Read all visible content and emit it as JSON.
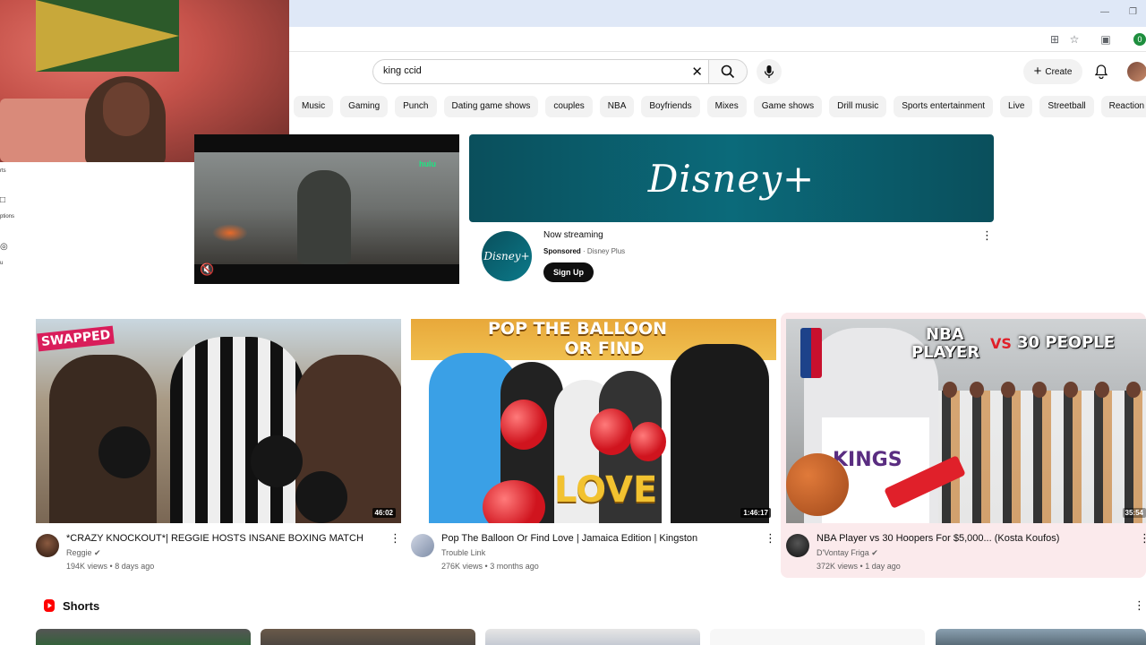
{
  "browser": {
    "profile_initial": "0",
    "icons": [
      "install-icon",
      "star-icon",
      "extensions-icon",
      "minimize-icon",
      "restore-icon"
    ]
  },
  "header": {
    "search_value": "king ccid",
    "create_label": "Create"
  },
  "chips": [
    "Music",
    "Gaming",
    "Punch",
    "Dating game shows",
    "couples",
    "NBA",
    "Boyfriends",
    "Mixes",
    "Game shows",
    "Drill music",
    "Sports entertainment",
    "Live",
    "Streetball",
    "Reaction vic"
  ],
  "ad": {
    "brand_logo_text": "Disney+",
    "video_badge": "hulu",
    "title": "Now streaming",
    "sponsored_label": "Sponsored",
    "advertiser": "Disney Plus",
    "cta_label": "Sign Up"
  },
  "videos": [
    {
      "title": "*CRAZY KNOCKOUT*| REGGIE HOSTS INSANE BOXING MATCH",
      "channel": "Reggie",
      "views": "194K views",
      "age": "8 days ago",
      "duration": "46:02",
      "thumb_text": "SWAPPED"
    },
    {
      "title": "Pop The Balloon Or Find Love | Jamaica Edition | Kingston",
      "channel": "Trouble Link",
      "views": "276K views",
      "age": "3 months ago",
      "duration": "1:46:17",
      "thumb_text_top": "POP THE BALLOON",
      "thumb_text_mid": "OR FIND",
      "thumb_text_love": "LOVE"
    },
    {
      "title": "NBA Player vs 30 Hoopers For $5,000... (Kosta Koufos)",
      "channel": "D'Vontay Friga",
      "views": "372K views",
      "age": "1 day ago",
      "duration": "35:54",
      "thumb_text_a": "NBA",
      "thumb_text_b": "PLAYER",
      "thumb_text_vs": "VS",
      "thumb_text_c": "30 PEOPLE",
      "thumb_jersey": "KINGS"
    }
  ],
  "shorts": {
    "label": "Shorts"
  },
  "sidebar_fragments": [
    "rts",
    "ptions",
    "u"
  ],
  "colors": {
    "accent_red": "#ff0000",
    "chip_bg": "#f2f2f2",
    "disney_teal": "#0a4f5c"
  }
}
